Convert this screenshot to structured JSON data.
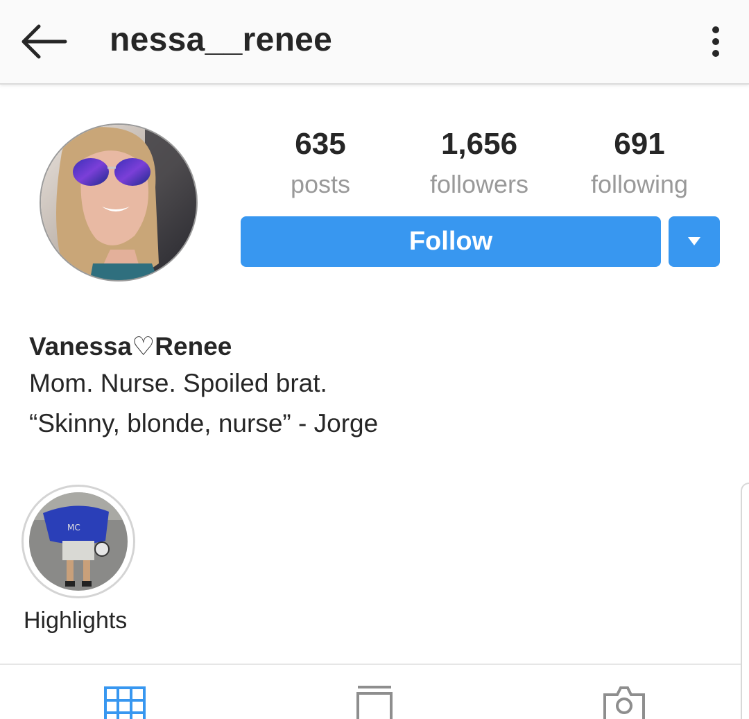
{
  "header": {
    "back_icon": "arrow-left-icon",
    "username": "nessa__renee",
    "menu_icon": "more-vertical-icon"
  },
  "profile": {
    "avatar": "profile-photo",
    "stats": [
      {
        "value": "635",
        "label": "posts"
      },
      {
        "value": "1,656",
        "label": "followers"
      },
      {
        "value": "691",
        "label": "following"
      }
    ],
    "follow_label": "Follow",
    "dropdown_icon": "caret-down-icon",
    "full_name": "Vanessa♡Renee",
    "bio": [
      "Mom. Nurse. Spoiled brat.",
      "“Skinny, blonde, nurse” - Jorge"
    ]
  },
  "highlights": [
    {
      "label": "Highlights",
      "thumbnail": "football-player-photo"
    }
  ],
  "tabs": [
    {
      "icon": "grid-icon",
      "active": true
    },
    {
      "icon": "feed-icon",
      "active": false
    },
    {
      "icon": "tagged-camera-icon",
      "active": false
    }
  ],
  "colors": {
    "accent": "#3897f0",
    "text": "#262626",
    "muted": "#999999",
    "header_bg": "#fafafa"
  }
}
